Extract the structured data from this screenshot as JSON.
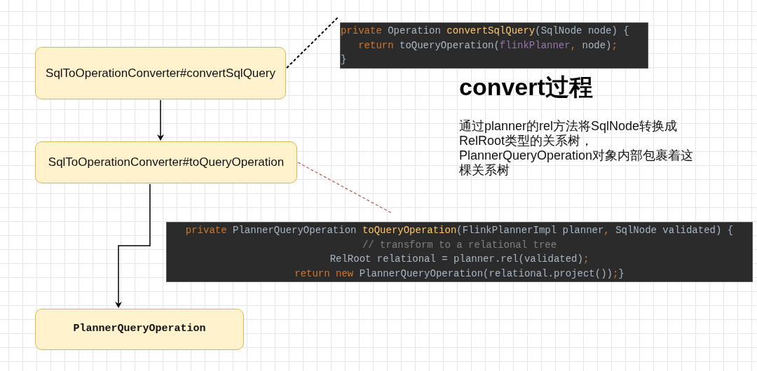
{
  "nodes": [
    {
      "label": "SqlToOperationConverter#convertSqlQuery",
      "kind": "sans"
    },
    {
      "label": "SqlToOperationConverter#toQueryOperation",
      "kind": "sans"
    },
    {
      "label": "PlannerQueryOperation",
      "kind": "mono"
    }
  ],
  "code_blocks": [
    {
      "lines": [
        [
          {
            "kind": "keyword",
            "text": "private "
          },
          {
            "kind": "plain",
            "text": "Operation "
          },
          {
            "kind": "method",
            "text": "convertSqlQuery"
          },
          {
            "kind": "plain",
            "text": "(SqlNode node) {"
          }
        ],
        [
          {
            "kind": "keyword",
            "text": "   return "
          },
          {
            "kind": "plain",
            "text": "toQueryOperation("
          },
          {
            "kind": "field",
            "text": "flinkPlanner"
          },
          {
            "kind": "keyword",
            "text": ", "
          },
          {
            "kind": "plain",
            "text": "node)"
          },
          {
            "kind": "keyword",
            "text": ";"
          }
        ],
        [
          {
            "kind": "plain",
            "text": "}"
          }
        ]
      ]
    },
    {
      "lines": [
        [
          {
            "kind": "keyword",
            "text": "private "
          },
          {
            "kind": "plain",
            "text": "PlannerQueryOperation "
          },
          {
            "kind": "method",
            "text": "toQueryOperation"
          },
          {
            "kind": "plain",
            "text": "(FlinkPlannerImpl planner"
          },
          {
            "kind": "keyword",
            "text": ", "
          },
          {
            "kind": "plain",
            "text": "SqlNode validated) {"
          }
        ],
        [
          {
            "kind": "comment",
            "text": "// transform to a relational tree"
          }
        ],
        [
          {
            "kind": "plain",
            "text": "RelRoot relational = planner.rel(validated)"
          },
          {
            "kind": "keyword",
            "text": ";"
          }
        ],
        [
          {
            "kind": "keyword",
            "text": "return new "
          },
          {
            "kind": "plain",
            "text": "PlannerQueryOperation(relational.project())"
          },
          {
            "kind": "keyword",
            "text": ";"
          },
          {
            "kind": "plain",
            "text": "}"
          }
        ]
      ]
    }
  ],
  "note": {
    "title": "convert过程",
    "body": "通过planner的rel方法将SqlNode转换成RelRoot类型的关系树，PlannerQueryOperation对象内部包裹着这棵关系树"
  }
}
